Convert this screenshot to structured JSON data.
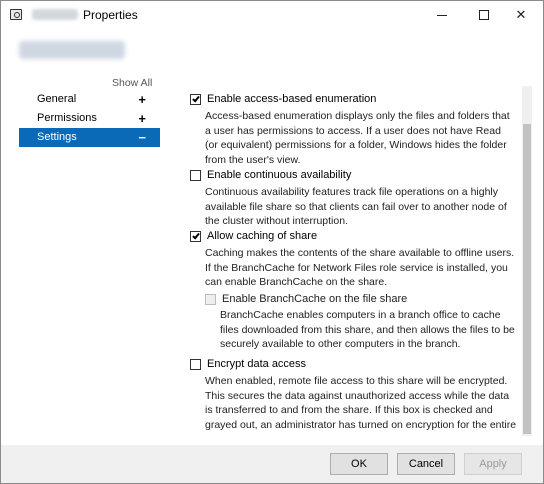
{
  "window": {
    "title": "Properties",
    "controls": {
      "minimize": "─",
      "maximize": "☐",
      "close": "✕"
    }
  },
  "sidebar": {
    "show_all": "Show All",
    "items": [
      {
        "label": "General",
        "symbol": "+"
      },
      {
        "label": "Permissions",
        "symbol": "+"
      },
      {
        "label": "Settings",
        "symbol": "−"
      }
    ]
  },
  "settings": {
    "abe": {
      "label": "Enable access-based enumeration",
      "checked": true,
      "description": "Access-based enumeration displays only the files and folders that a user has permissions to access. If a user does not have Read (or equivalent) permissions for a folder, Windows hides the folder from the user's view."
    },
    "ca": {
      "label": "Enable continuous availability",
      "checked": false,
      "description": "Continuous availability features track file operations on a highly available file share so that clients can fail over to another node of the cluster without interruption."
    },
    "caching": {
      "label": "Allow caching of share",
      "checked": true,
      "description": "Caching makes the contents of the share available to offline users. If the BranchCache for Network Files role service is installed, you can enable BranchCache on the share."
    },
    "branchcache": {
      "label": "Enable BranchCache on the file share",
      "checked": false,
      "disabled": true,
      "description": "BranchCache enables computers in a branch office to cache files downloaded from this share, and then allows the files to be securely available to other computers in the branch."
    },
    "encrypt": {
      "label": "Encrypt data access",
      "checked": false,
      "description": "When enabled, remote file access to this share will be encrypted. This secures the data against unauthorized access while the data is transferred to and from the share. If this box is checked and grayed out, an administrator has turned on encryption for the entire server."
    }
  },
  "buttons": {
    "ok": "OK",
    "cancel": "Cancel",
    "apply": "Apply"
  },
  "colors": {
    "accent": "#0a6ab8",
    "footer": "#f0f0f0"
  }
}
